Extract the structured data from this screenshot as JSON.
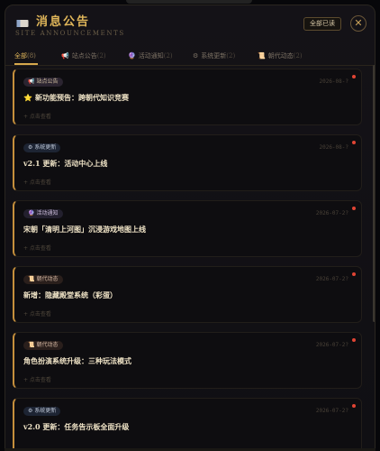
{
  "header": {
    "title": "消息公告",
    "subtitle": "SITE ANNOUNCEMENTS",
    "mark_all_read": "全部已读",
    "close": "✕"
  },
  "tabs": [
    {
      "label": "全部",
      "count": "(8)",
      "icon": ""
    },
    {
      "label": "站点公告",
      "count": "(2)",
      "icon": "📢"
    },
    {
      "label": "活动通知",
      "count": "(2)",
      "icon": "🔮"
    },
    {
      "label": "系统更新",
      "count": "(2)",
      "icon": "⚙"
    },
    {
      "label": "朝代动态",
      "count": "(2)",
      "icon": "📜"
    }
  ],
  "cards": [
    {
      "badge": "站点公告",
      "badge_icon": "📢",
      "date": "2026-08-?",
      "title": "新功能预告：跨朝代知识竞赛",
      "star": "⭐",
      "more": "+ 点击查看"
    },
    {
      "badge": "系统更新",
      "badge_icon": "⚙",
      "date": "2026-08-?",
      "title": "v2.1 更新：活动中心上线",
      "star": "",
      "more": "+ 点击查看"
    },
    {
      "badge": "活动通知",
      "badge_icon": "🔮",
      "date": "2026-07-2?",
      "title": "宋朝「清明上河图」沉浸游戏地图上线",
      "star": "",
      "more": "+ 点击查看"
    },
    {
      "badge": "朝代动态",
      "badge_icon": "📜",
      "date": "2026-07-2?",
      "title": "新增：隐藏殿堂系统（彩蛋）",
      "star": "",
      "more": "+ 点击查看"
    },
    {
      "badge": "朝代动态",
      "badge_icon": "📜",
      "date": "2026-07-2?",
      "title": "角色扮演系统升级：三种玩法模式",
      "star": "",
      "more": "+ 点击查看"
    },
    {
      "badge": "系统更新",
      "badge_icon": "⚙",
      "date": "2026-07-2?",
      "title": "v2.0 更新：任务告示板全面升级",
      "star": "",
      "more": ""
    }
  ],
  "colors": {
    "accent": "#e0b65a",
    "unread_dot": "#e04434"
  }
}
